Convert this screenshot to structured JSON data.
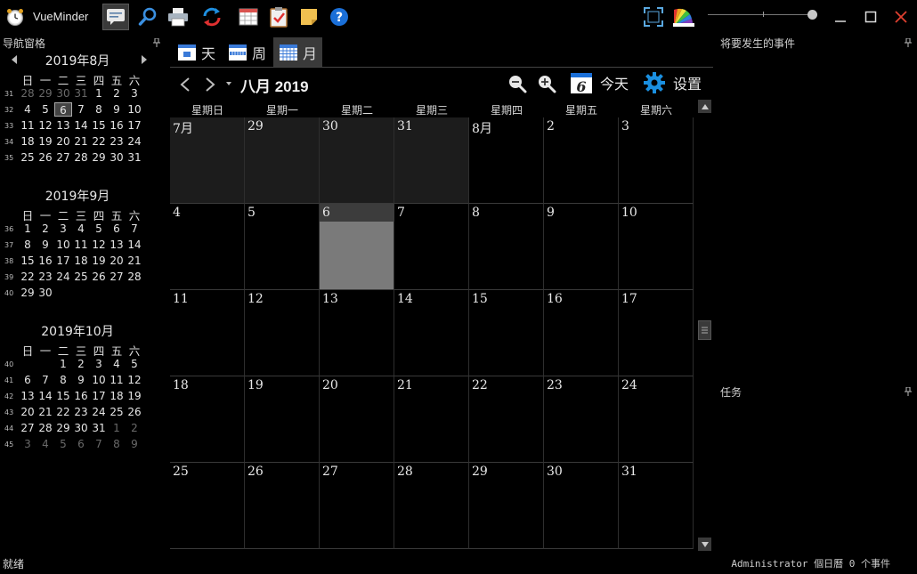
{
  "app": {
    "title": "VueMinder"
  },
  "nav": {
    "title": "导航窗格",
    "dow": [
      "日",
      "一",
      "二",
      "三",
      "四",
      "五",
      "六"
    ],
    "months": [
      {
        "title": "2019年8月",
        "weeks": [
          {
            "wk": "31",
            "days": [
              "28",
              "29",
              "30",
              "31",
              "1",
              "2",
              "3"
            ],
            "other": [
              0,
              1,
              2,
              3
            ]
          },
          {
            "wk": "32",
            "days": [
              "4",
              "5",
              "6",
              "7",
              "8",
              "9",
              "10"
            ],
            "other": [],
            "sel": 2
          },
          {
            "wk": "33",
            "days": [
              "11",
              "12",
              "13",
              "14",
              "15",
              "16",
              "17"
            ],
            "other": []
          },
          {
            "wk": "34",
            "days": [
              "18",
              "19",
              "20",
              "21",
              "22",
              "23",
              "24"
            ],
            "other": []
          },
          {
            "wk": "35",
            "days": [
              "25",
              "26",
              "27",
              "28",
              "29",
              "30",
              "31"
            ],
            "other": []
          }
        ]
      },
      {
        "title": "2019年9月",
        "weeks": [
          {
            "wk": "36",
            "days": [
              "1",
              "2",
              "3",
              "4",
              "5",
              "6",
              "7"
            ],
            "other": []
          },
          {
            "wk": "37",
            "days": [
              "8",
              "9",
              "10",
              "11",
              "12",
              "13",
              "14"
            ],
            "other": []
          },
          {
            "wk": "38",
            "days": [
              "15",
              "16",
              "17",
              "18",
              "19",
              "20",
              "21"
            ],
            "other": []
          },
          {
            "wk": "39",
            "days": [
              "22",
              "23",
              "24",
              "25",
              "26",
              "27",
              "28"
            ],
            "other": []
          },
          {
            "wk": "40",
            "days": [
              "29",
              "30",
              "",
              "",
              "",
              "",
              ""
            ],
            "other": []
          }
        ]
      },
      {
        "title": "2019年10月",
        "weeks": [
          {
            "wk": "40",
            "days": [
              "",
              "",
              "1",
              "2",
              "3",
              "4",
              "5"
            ],
            "other": []
          },
          {
            "wk": "41",
            "days": [
              "6",
              "7",
              "8",
              "9",
              "10",
              "11",
              "12"
            ],
            "other": []
          },
          {
            "wk": "42",
            "days": [
              "13",
              "14",
              "15",
              "16",
              "17",
              "18",
              "19"
            ],
            "other": []
          },
          {
            "wk": "43",
            "days": [
              "20",
              "21",
              "22",
              "23",
              "24",
              "25",
              "26"
            ],
            "other": []
          },
          {
            "wk": "44",
            "days": [
              "27",
              "28",
              "29",
              "30",
              "31",
              "1",
              "2"
            ],
            "other": [
              5,
              6
            ]
          },
          {
            "wk": "45",
            "days": [
              "3",
              "4",
              "5",
              "6",
              "7",
              "8",
              "9"
            ],
            "other": [
              0,
              1,
              2,
              3,
              4,
              5,
              6
            ]
          }
        ]
      }
    ]
  },
  "views": {
    "day": "天",
    "week": "周",
    "month": "月"
  },
  "calendar": {
    "title": "八月 2019",
    "today_label": "今天",
    "today_icon_num": "6",
    "settings_label": "设置",
    "dow": [
      "星期日",
      "星期一",
      "星期二",
      "星期三",
      "星期四",
      "星期五",
      "星期六"
    ],
    "weeks": [
      [
        "7月",
        "29",
        "30",
        "31",
        "8月",
        "2",
        "3"
      ],
      [
        "4",
        "5",
        "6",
        "7",
        "8",
        "9",
        "10"
      ],
      [
        "11",
        "12",
        "13",
        "14",
        "15",
        "16",
        "17"
      ],
      [
        "18",
        "19",
        "20",
        "21",
        "22",
        "23",
        "24"
      ],
      [
        "25",
        "26",
        "27",
        "28",
        "29",
        "30",
        "31"
      ]
    ],
    "prev_month_cells": 4,
    "today_week": 1,
    "today_col": 2
  },
  "right": {
    "upcoming_title": "将要发生的事件",
    "tasks_title": "任务"
  },
  "status": {
    "left": "就绪",
    "right": "Administrator 個日曆 0 个事件"
  }
}
